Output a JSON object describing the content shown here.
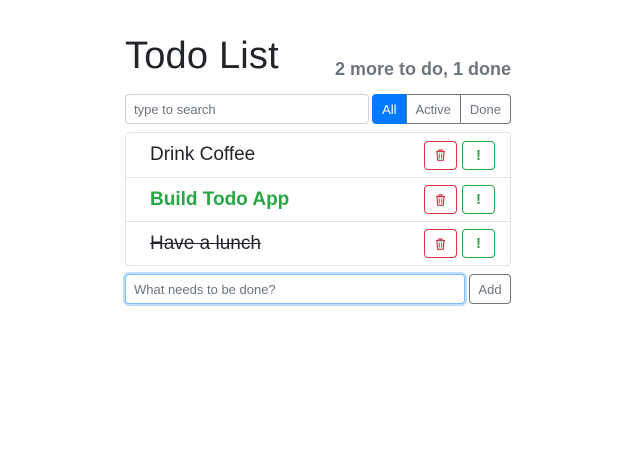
{
  "header": {
    "title": "Todo List",
    "status": "2 more to do, 1 done"
  },
  "search": {
    "placeholder": "type to search"
  },
  "filters": [
    {
      "label": "All",
      "active": true
    },
    {
      "label": "Active",
      "active": false
    },
    {
      "label": "Done",
      "active": false
    }
  ],
  "todos": [
    {
      "label": "Drink Coffee",
      "important": false,
      "done": false,
      "delete_icon": "trash-icon",
      "important_icon": "exclamation-icon"
    },
    {
      "label": "Build Todo App",
      "important": true,
      "done": false,
      "delete_icon": "trash-icon",
      "important_icon": "exclamation-icon"
    },
    {
      "label": "Have a lunch",
      "important": false,
      "done": true,
      "delete_icon": "trash-icon",
      "important_icon": "exclamation-icon"
    }
  ],
  "add_form": {
    "placeholder": "What needs to be done?",
    "button_label": "Add"
  },
  "colors": {
    "primary": "#007bff",
    "danger": "#dc3545",
    "success": "#28a745",
    "secondary": "#6c757d"
  }
}
